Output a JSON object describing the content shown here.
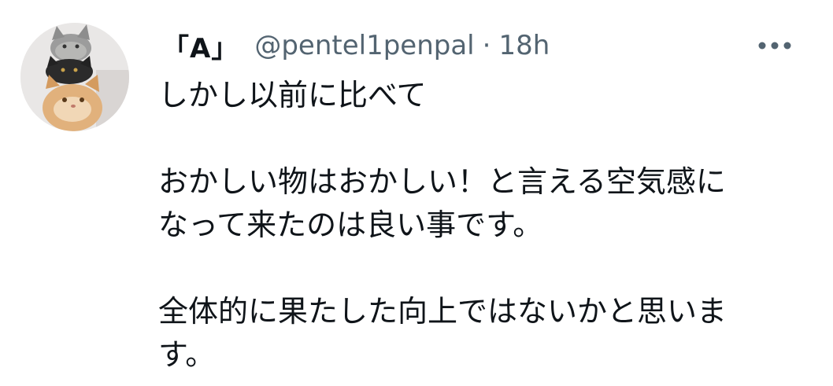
{
  "tweet": {
    "display_name": "「A」",
    "handle": "@pentel1penpal",
    "separator": "·",
    "time": "18h",
    "more_icon": "more-horizontal-icon",
    "avatar_icon": "cats-stack-avatar",
    "body_lines": [
      "しかし以前に比べて",
      "",
      "おかしい物はおかしい！と言える空気感に",
      "なって来たのは良い事です。",
      "",
      "全体的に果たした向上ではないかと思いま",
      "す。"
    ]
  },
  "colors": {
    "text_primary": "#0f1419",
    "text_secondary": "#536471",
    "background": "#ffffff"
  }
}
